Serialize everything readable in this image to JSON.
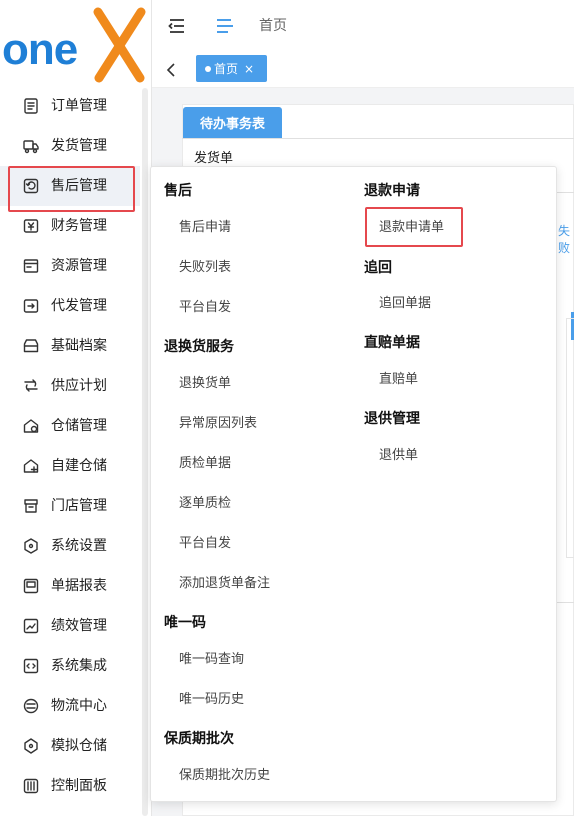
{
  "logo_text": "oneX",
  "sidebar": {
    "items": [
      {
        "label": "订单管理",
        "icon": "order-icon"
      },
      {
        "label": "发货管理",
        "icon": "truck-icon"
      },
      {
        "label": "售后管理",
        "icon": "after-sales-icon"
      },
      {
        "label": "财务管理",
        "icon": "finance-icon"
      },
      {
        "label": "资源管理",
        "icon": "resource-icon"
      },
      {
        "label": "代发管理",
        "icon": "dropship-icon"
      },
      {
        "label": "基础档案",
        "icon": "archive-icon"
      },
      {
        "label": "供应计划",
        "icon": "supply-plan-icon"
      },
      {
        "label": "仓储管理",
        "icon": "warehouse-icon"
      },
      {
        "label": "自建仓储",
        "icon": "self-warehouse-icon"
      },
      {
        "label": "门店管理",
        "icon": "store-icon"
      },
      {
        "label": "系统设置",
        "icon": "settings-icon"
      },
      {
        "label": "单据报表",
        "icon": "report-icon"
      },
      {
        "label": "绩效管理",
        "icon": "kpi-icon"
      },
      {
        "label": "系统集成",
        "icon": "integration-icon"
      },
      {
        "label": "物流中心",
        "icon": "logistics-icon"
      },
      {
        "label": "模拟仓储",
        "icon": "simulated-warehouse-icon"
      },
      {
        "label": "控制面板",
        "icon": "control-panel-icon"
      }
    ]
  },
  "topbar": {
    "breadcrumb": "首页"
  },
  "tabs": [
    {
      "label": "首页",
      "close": "×"
    }
  ],
  "card": {
    "tab_label": "待办事务表",
    "sub_label": "发货单",
    "edge_text": "失败"
  },
  "popup": {
    "groups": [
      {
        "title": "售后",
        "items": [
          "售后申请",
          "失败列表",
          "平台自发"
        ]
      },
      {
        "title": "退换货服务",
        "items": [
          "退换货单",
          "异常原因列表",
          "质检单据",
          "逐单质检",
          "平台自发",
          "添加退货单备注"
        ]
      },
      {
        "title": "唯一码",
        "items": [
          "唯一码查询",
          "唯一码历史"
        ]
      },
      {
        "title": "保质期批次",
        "items": [
          "保质期批次历史"
        ]
      },
      {
        "title": "退款申请",
        "items": [
          "退款申请单"
        ]
      },
      {
        "title": "追回",
        "items": [
          "追回单据"
        ]
      },
      {
        "title": "直赔单据",
        "items": [
          "直赔单"
        ]
      },
      {
        "title": "退供管理",
        "items": [
          "退供单"
        ]
      }
    ]
  },
  "colors": {
    "accent": "#4a9eea",
    "logo_blue": "#1f7fd6",
    "logo_orange": "#f08a1c",
    "highlight": "#e5484d"
  }
}
